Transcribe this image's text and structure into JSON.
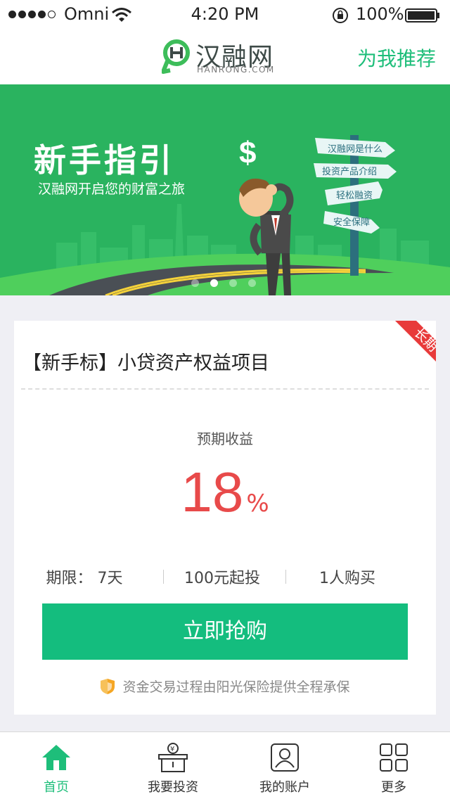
{
  "status_bar": {
    "carrier": "Omni",
    "time": "4:20 PM",
    "battery": "100%"
  },
  "nav": {
    "logo_cn": "汉融网",
    "logo_en": "HANRONG.COM",
    "recommend_label": "为我推荐"
  },
  "banner": {
    "title": "新手指引",
    "subtitle": "汉融网开启您的财富之旅",
    "signs": [
      "汉融网是什么",
      "投资产品介绍",
      "轻松融资",
      "安全保障"
    ],
    "active_slide": 2,
    "slide_count": 4
  },
  "product": {
    "badge": "长期",
    "title": "【新手标】小贷资产权益项目",
    "yield_label": "预期收益",
    "yield_value": "18",
    "yield_unit": "%",
    "term": "期限： 7天",
    "min_invest": "100元起投",
    "buyers": "1人购买",
    "buy_label": "立即抢购",
    "insurance_note": "资金交易过程由阳光保险提供全程承保"
  },
  "tabs": [
    {
      "label": "首页",
      "icon": "home-icon",
      "active": true
    },
    {
      "label": "我要投资",
      "icon": "invest-box-icon",
      "active": false
    },
    {
      "label": "我的账户",
      "icon": "account-icon",
      "active": false
    },
    {
      "label": "更多",
      "icon": "grid-icon",
      "active": false
    }
  ],
  "colors": {
    "brand_green": "#1ebe7a",
    "banner_green": "#2ab35f",
    "button_green": "#14bd7e",
    "yield_red": "#e84a4a",
    "ribbon_red": "#e83a3a"
  }
}
